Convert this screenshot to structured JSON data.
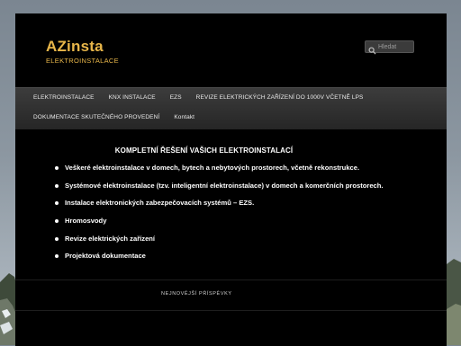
{
  "header": {
    "site_title": "AZinsta",
    "site_description": "ELEKTROINSTALACE"
  },
  "search": {
    "placeholder": "Hledat",
    "icon": "search-icon"
  },
  "nav": {
    "row1": [
      {
        "label": "ELEKTROINSTALACE"
      },
      {
        "label": "KNX INSTALACE"
      },
      {
        "label": "EZS"
      },
      {
        "label": "REVIZE ELEKTRICKÝCH ZAŘÍZENÍ DO 1000V VČETNĚ LPS"
      }
    ],
    "row2": [
      {
        "label": "DOKUMENTACE SKUTEČNÉHO PROVEDENÍ"
      },
      {
        "label": "Kontakt"
      }
    ]
  },
  "main": {
    "heading": "KOMPLETNÍ ŘEŠENÍ VAŠICH ELEKTROINSTALACÍ",
    "items": [
      "Veškeré elektroinstalace v domech, bytech a nebytových prostorech, včetně rekonstrukce.",
      "Systémové elektroinstalace (tzv. inteligentní elektroinstalace) v domech a komerčních prostorech.",
      "Instalace elektronických zabezpečovacích systémů – EZS.",
      "Hromosvody",
      "Revize elektrických zařízení",
      "Projektová dokumentace"
    ]
  },
  "footer": {
    "recent_posts_label": "NEJNOVĚJŠÍ PŘÍSPĚVKY"
  },
  "colors": {
    "accent": "#e8b64a",
    "page_background": "#000000",
    "nav_background": "#2e2e2e"
  }
}
